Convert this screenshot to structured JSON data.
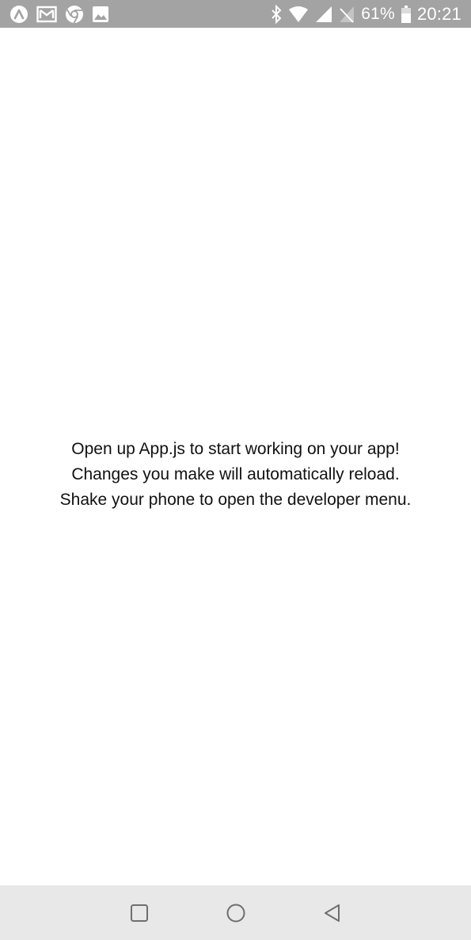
{
  "status_bar": {
    "left_icons": [
      "expo-icon",
      "gmail-icon",
      "chrome-icon",
      "gallery-icon"
    ],
    "right_icons": [
      "bluetooth-icon",
      "wifi-icon",
      "signal-icon",
      "no-sim-icon"
    ],
    "battery_percent": "61%",
    "battery_icon": "battery-icon",
    "time": "20:21",
    "background_color": "#a3a3a3"
  },
  "app": {
    "background_color": "#ffffff",
    "message": {
      "line1": "Open up App.js to start working on your app!",
      "line2": "Changes you make will automatically reload.",
      "line3": "Shake your phone to open the developer menu."
    }
  },
  "nav_bar": {
    "background_color": "#e8e8e8",
    "buttons": [
      "recent-apps-icon",
      "home-icon",
      "back-icon"
    ]
  }
}
